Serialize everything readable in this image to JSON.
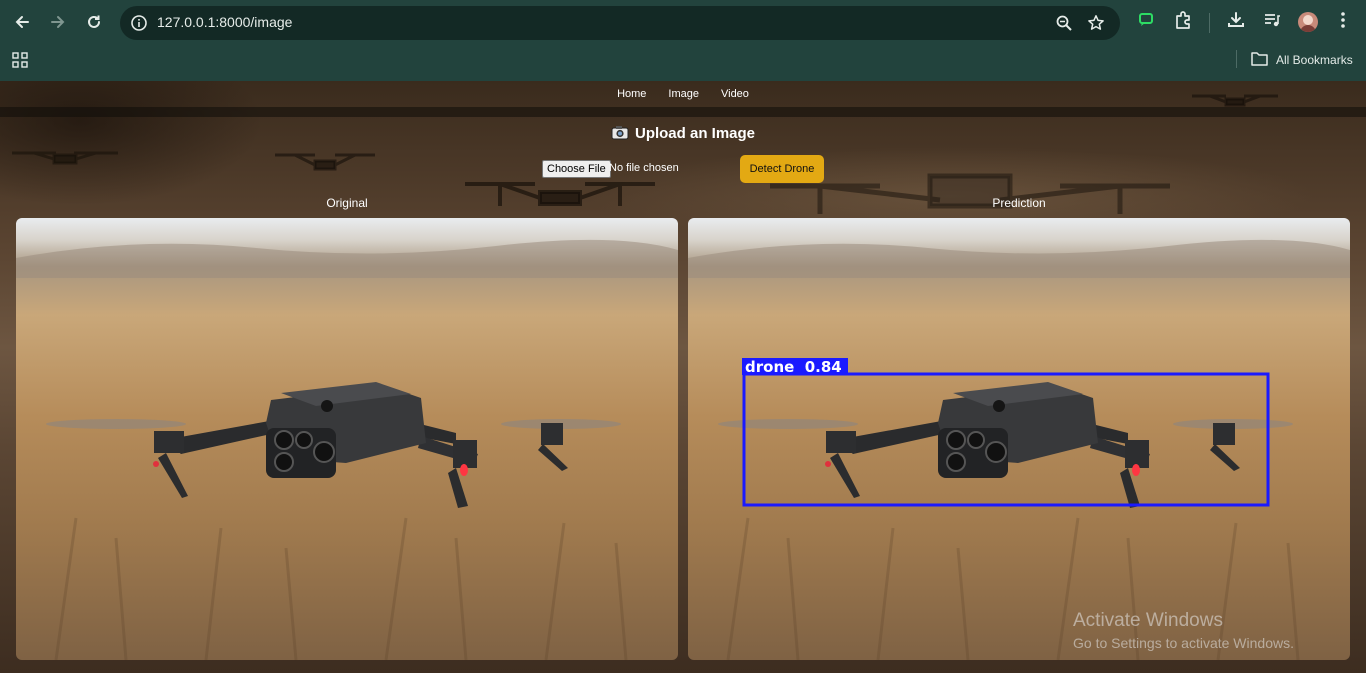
{
  "browser": {
    "url": "127.0.0.1:8000/image",
    "bookmarks_label": "All Bookmarks",
    "icons": [
      "back-arrow-icon",
      "forward-arrow-icon",
      "reload-icon",
      "site-info-icon",
      "zoom-icon",
      "star-icon",
      "chat-icon",
      "extensions-icon",
      "download-icon",
      "reading-list-icon",
      "avatar",
      "more-menu-icon",
      "apps-grid-icon",
      "folder-icon"
    ]
  },
  "nav": {
    "links": [
      "Home",
      "Image",
      "Video"
    ]
  },
  "upload": {
    "title": "Upload an Image",
    "choose_file_label": "Choose File",
    "file_status": "No file chosen",
    "detect_button": "Detect Drone"
  },
  "panels": {
    "original_label": "Original",
    "prediction_label": "Prediction",
    "detection_label": "drone  0.84",
    "box_color": "#1a1aff"
  },
  "watermark": {
    "title": "Activate Windows",
    "subtitle": "Go to Settings to activate Windows."
  },
  "colors": {
    "chrome_bg": "#22433d",
    "omnibox_bg": "#132925",
    "detect_button": "#e3a913"
  }
}
